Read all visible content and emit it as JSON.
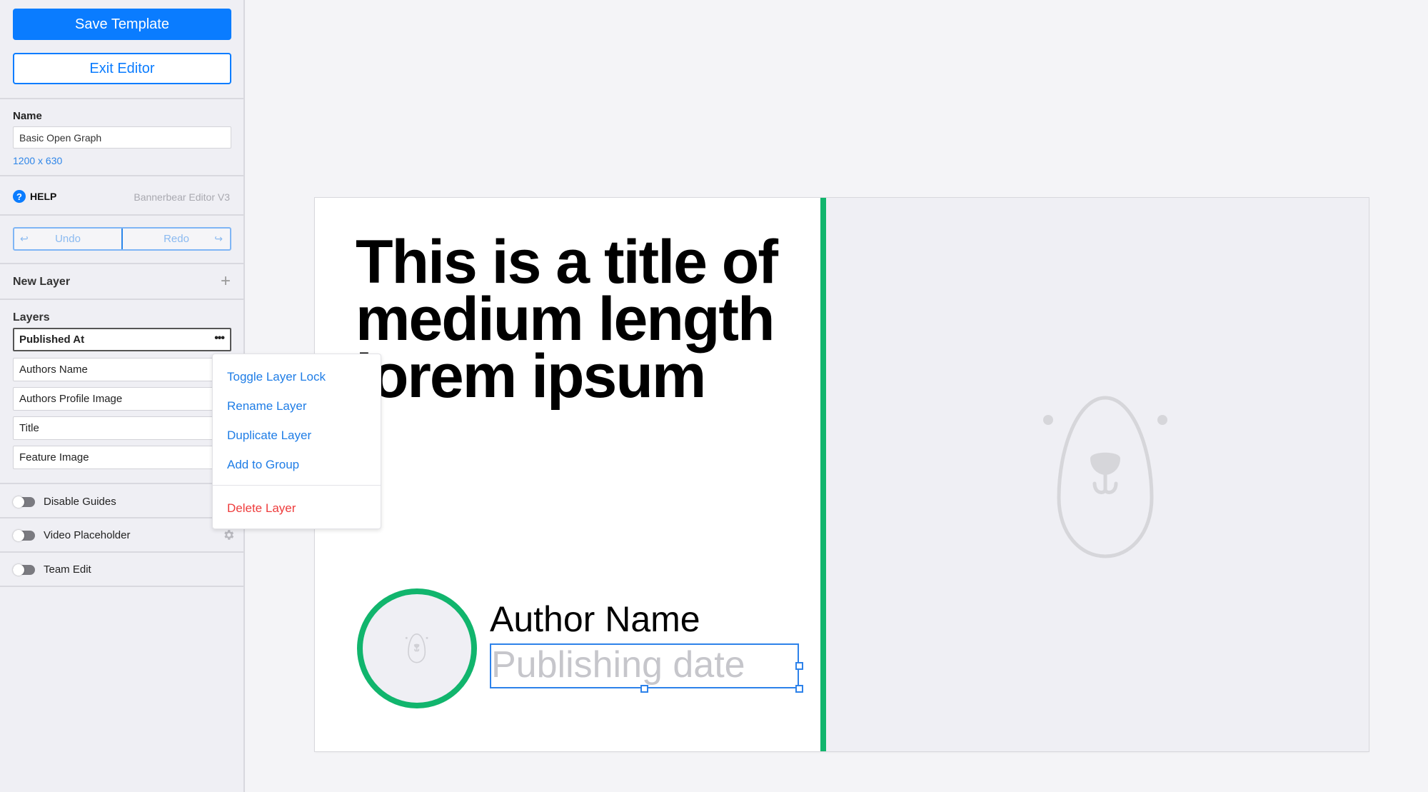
{
  "sidebar": {
    "save_label": "Save Template",
    "exit_label": "Exit Editor",
    "name_label": "Name",
    "name_value": "Basic Open Graph",
    "size": "1200 x 630",
    "help_icon": "?",
    "help_label": "HELP",
    "version": "Bannerbear Editor V3",
    "undo_label": "Undo",
    "redo_label": "Redo",
    "undo_icon": "↩",
    "redo_icon": "↪",
    "new_layer_label": "New Layer",
    "plus_icon": "+",
    "layers_label": "Layers",
    "layers": [
      {
        "label": "Published At",
        "active": true
      },
      {
        "label": "Authors Name"
      },
      {
        "label": "Authors Profile Image"
      },
      {
        "label": "Title"
      },
      {
        "label": "Feature Image"
      }
    ],
    "more_icon": "•••",
    "toggles": [
      {
        "label": "Disable Guides",
        "on": false
      },
      {
        "label": "Video Placeholder",
        "on": false
      },
      {
        "label": "Team Edit",
        "on": false
      }
    ]
  },
  "context_menu": {
    "items": [
      {
        "label": "Toggle Layer Lock"
      },
      {
        "label": "Rename Layer"
      },
      {
        "label": "Duplicate Layer"
      },
      {
        "label": "Add to Group"
      },
      {
        "label": "Delete Layer",
        "danger": true
      }
    ]
  },
  "canvas": {
    "title_line1": "This is a title of",
    "title_line2": "medium length",
    "title_line3": "lorem ipsum",
    "author_name": "Author Name",
    "publishing_date": "Publishing date",
    "colors": {
      "accent": "#11b56d",
      "placeholder_bg": "#efeff4",
      "selection": "#2d82ea"
    }
  },
  "colors": {
    "primary": "#0a7cff",
    "danger": "#ee3c3c"
  }
}
